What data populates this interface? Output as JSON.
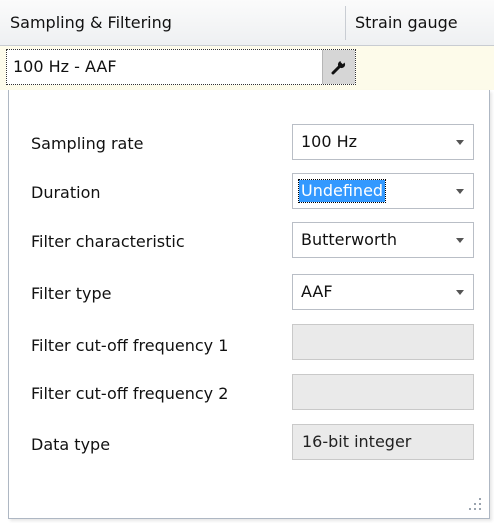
{
  "header": {
    "col1": "Sampling & Filtering",
    "col2": "Strain gauge"
  },
  "preset": {
    "value": "100 Hz - AAF",
    "icon": "wrench-icon"
  },
  "rows": [
    {
      "label": "Sampling rate",
      "value": "100 Hz",
      "state": "dropdown"
    },
    {
      "label": "Duration",
      "value": "Undefined",
      "state": "dropdown-selected"
    },
    {
      "label": "Filter characteristic",
      "value": "Butterworth",
      "state": "dropdown"
    },
    {
      "label": "Filter type",
      "value": "AAF",
      "state": "dropdown"
    },
    {
      "label": "Filter cut-off frequency 1",
      "value": "",
      "state": "disabled"
    },
    {
      "label": "Filter cut-off frequency 2",
      "value": "",
      "state": "disabled"
    },
    {
      "label": "Data type",
      "value": "16-bit integer",
      "state": "readonly"
    }
  ],
  "colors": {
    "selection": "#3399ff",
    "highlight_row": "#fdfbea",
    "disabled_field": "#eaeaea"
  }
}
